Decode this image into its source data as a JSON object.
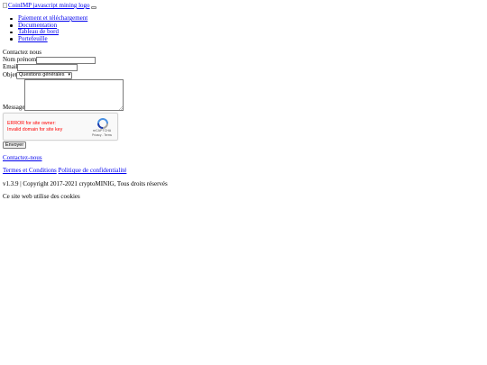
{
  "header": {
    "logo_alt": "CoinIMP javascript mining logo"
  },
  "nav": {
    "items": [
      {
        "label": "Paiement et téléchargement"
      },
      {
        "label": "Documentation"
      },
      {
        "label": "Tableau de bord"
      },
      {
        "label": "Portefeuille"
      }
    ]
  },
  "contact_form": {
    "title": "Contactez nous",
    "name_label": "Nom prénom",
    "email_label": "Email",
    "subject_label": "Objet",
    "subject_selected": "Questions générales",
    "message_label": "Message",
    "submit_label": "Envoyer",
    "name_value": "",
    "email_value": ""
  },
  "recaptcha": {
    "error_line1": "ERROR for site owner:",
    "error_line2": "Invalid domain for site key",
    "brand": "reCAPTCHA",
    "links": "Privacy - Terms"
  },
  "footer": {
    "contact_link": "Contactez-nous",
    "terms_link": "Termes et Conditions",
    "privacy_link": "Politique de confidentialité",
    "copyright": "v1.3.9 | Copyright 2017-2021 cryptoMINIG, Tous droits réservés",
    "cookies": "Ce site web utilise des cookies"
  },
  "colors": {
    "link": "#0000ee",
    "error": "#ff0000",
    "recaptcha_blue": "#4a90e2",
    "recaptcha_gray": "#a6a6a6"
  }
}
